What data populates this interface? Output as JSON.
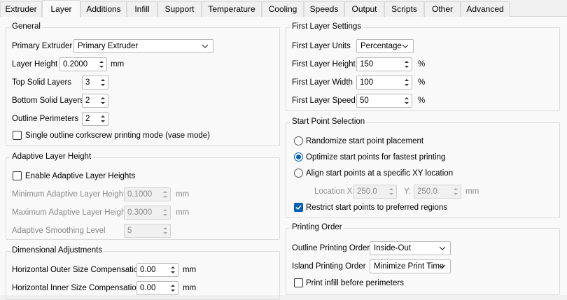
{
  "tabs": [
    "Extruder",
    "Layer",
    "Additions",
    "Infill",
    "Support",
    "Temperature",
    "Cooling",
    "Speeds",
    "Output",
    "Scripts",
    "Other",
    "Advanced"
  ],
  "active_tab": "Layer",
  "general": {
    "title": "General",
    "primary_extruder_label": "Primary Extruder",
    "primary_extruder_value": "Primary Extruder",
    "layer_height_label": "Layer Height",
    "layer_height_value": "0.2000",
    "layer_height_unit": "mm",
    "top_solid_label": "Top Solid Layers",
    "top_solid_value": "3",
    "bottom_solid_label": "Bottom Solid Layers",
    "bottom_solid_value": "2",
    "outline_perimeters_label": "Outline Perimeters",
    "outline_perimeters_value": "2",
    "vase_mode_label": "Single outline corkscrew printing mode (vase mode)",
    "vase_mode_checked": false
  },
  "adaptive": {
    "title": "Adaptive Layer Height",
    "enable_label": "Enable Adaptive Layer Heights",
    "enable_checked": false,
    "min_label": "Minimum Adaptive Layer Height",
    "min_value": "0.1000",
    "min_unit": "mm",
    "max_label": "Maximum Adaptive Layer Height",
    "max_value": "0.3000",
    "max_unit": "mm",
    "smoothing_label": "Adaptive Smoothing Level",
    "smoothing_value": "5"
  },
  "dimensional": {
    "title": "Dimensional Adjustments",
    "outer_label": "Horizontal Outer Size Compensation",
    "outer_value": "0.00",
    "outer_unit": "mm",
    "inner_label": "Horizontal Inner Size Compensation",
    "inner_value": "0.00",
    "inner_unit": "mm"
  },
  "first_layer": {
    "title": "First Layer Settings",
    "units_label": "First Layer Units",
    "units_value": "Percentage",
    "height_label": "First Layer Height",
    "height_value": "150",
    "width_label": "First Layer Width",
    "width_value": "100",
    "speed_label": "First Layer Speed",
    "speed_value": "50",
    "percent": "%"
  },
  "start_point": {
    "title": "Start Point Selection",
    "randomize_label": "Randomize start point placement",
    "optimize_label": "Optimize start points for fastest printing",
    "align_label": "Align start points at a specific XY location",
    "selected": "optimize",
    "location_x_label": "Location X:",
    "location_x_value": "250.0",
    "y_label": "Y:",
    "y_value": "250.0",
    "unit": "mm",
    "restrict_label": "Restrict start points to preferred regions",
    "restrict_checked": true
  },
  "printing_order": {
    "title": "Printing Order",
    "outline_label": "Outline Printing Order",
    "outline_value": "Inside-Out",
    "island_label": "Island Printing Order",
    "island_value": "Minimize Print Time",
    "infill_first_label": "Print infill before perimeters",
    "infill_first_checked": false
  },
  "colors": {
    "accent": "#005fb8",
    "panel": "#f9f9f9",
    "window": "#f0f0f0"
  }
}
